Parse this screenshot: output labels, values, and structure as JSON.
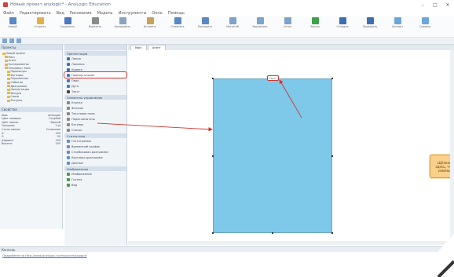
{
  "titlebar": {
    "title": "Новый проект.anylogic* - AnyLogic Education"
  },
  "window_controls": {
    "minimize": "–",
    "maximize": "□",
    "close": "✕"
  },
  "menubar": {
    "items": [
      "Файл",
      "Редактировать",
      "Вид",
      "Рисование",
      "Модель",
      "Инструменты",
      "Окно",
      "Помощь"
    ]
  },
  "ribbon": {
    "buttons": [
      {
        "label": "Новый",
        "color": "#5b87c7"
      },
      {
        "label": "Открыть",
        "color": "#e2b04a"
      },
      {
        "label": "Сохранить",
        "color": "#4a78b8"
      },
      {
        "label": "Вырезать",
        "color": "#8a8a8a"
      },
      {
        "label": "Копировать",
        "color": "#8aa3c2"
      },
      {
        "label": "Вставить",
        "color": "#c7a25b"
      },
      {
        "label": "Отменить",
        "color": "#5a88c0"
      },
      {
        "label": "Повторить",
        "color": "#5a88c0"
      },
      {
        "label": "Масштаб",
        "color": "#7ca3c9"
      },
      {
        "label": "Выровнять",
        "color": "#7ca3c9"
      },
      {
        "label": "Сетка",
        "color": "#7ca3c9"
      },
      {
        "label": "Запуск",
        "color": "#3fa14a"
      },
      {
        "label": "Отладка",
        "color": "#3d6fb0"
      },
      {
        "label": "Проверить",
        "color": "#3d6fb0"
      },
      {
        "label": "Экспорт",
        "color": "#6aa7d8"
      },
      {
        "label": "Справка",
        "color": "#6aa7d8"
      }
    ]
  },
  "left_panel": {
    "title": "Проекты",
    "tree": [
      "Новый проект",
      "Main",
      "Агент",
      "Эксперименты",
      "Simulation: Main",
      "Параметры",
      "Функции",
      "Переменные",
      "События",
      "Диаграммы",
      "Презентация",
      "Фигуры",
      "Связи",
      "Ресурсы"
    ],
    "props_title": "Свойства",
    "props": [
      {
        "k": "Имя:",
        "v": "rectangle"
      },
      {
        "k": "Цвет заливки:",
        "v": "Голубой"
      },
      {
        "k": "Цвет линии:",
        "v": "Чёрный"
      },
      {
        "k": "Толщина:",
        "v": "1 pt"
      },
      {
        "k": "Стиль линии:",
        "v": "Сплошная"
      },
      {
        "k": "X:",
        "v": "100"
      },
      {
        "k": "Y:",
        "v": "50"
      },
      {
        "k": "Ширина:",
        "v": "150"
      },
      {
        "k": "Высота:",
        "v": "200"
      }
    ]
  },
  "palette": {
    "sections": [
      {
        "title": "Презентация",
        "items": [
          {
            "label": "Линия",
            "color": "#3b6fb5"
          },
          {
            "label": "Ломаная",
            "color": "#3b6fb5"
          },
          {
            "label": "Кривая",
            "color": "#3b6fb5"
          },
          {
            "label": "Прямоугольник",
            "color": "#3a7bd5"
          },
          {
            "label": "Овал",
            "color": "#3a7bd5"
          },
          {
            "label": "Дуга",
            "color": "#3a7bd5"
          },
          {
            "label": "Текст",
            "color": "#444"
          }
        ]
      },
      {
        "title": "Элементы управления",
        "items": [
          {
            "label": "Кнопка",
            "color": "#888"
          },
          {
            "label": "Флажок",
            "color": "#888"
          },
          {
            "label": "Текстовое поле",
            "color": "#888"
          },
          {
            "label": "Переключатель",
            "color": "#888"
          },
          {
            "label": "Бегунок",
            "color": "#888"
          },
          {
            "label": "Список",
            "color": "#888"
          }
        ]
      },
      {
        "title": "Статистика",
        "items": [
          {
            "label": "Гистограмма",
            "color": "#5b8fd0"
          },
          {
            "label": "Временной график",
            "color": "#5b8fd0"
          },
          {
            "label": "Столбиковая диаграмма",
            "color": "#5b8fd0"
          },
          {
            "label": "Круговая диаграмма",
            "color": "#5b8fd0"
          },
          {
            "label": "Данные",
            "color": "#5b8fd0"
          }
        ]
      },
      {
        "title": "Изображения",
        "items": [
          {
            "label": "Изображение",
            "color": "#4a9a4a"
          },
          {
            "label": "Группа",
            "color": "#4a9a4a"
          },
          {
            "label": "Вид",
            "color": "#4a9a4a"
          }
        ]
      }
    ],
    "highlighted_item": "Прямоугольник"
  },
  "editor": {
    "tabs": [
      "Main",
      "Агент"
    ],
    "callout_text": "Щёлкните здесь, чтобы изменить",
    "anno_label": "Текст",
    "canvas_fill": "#7ec8ea"
  },
  "bottom_panel": {
    "title": "Консоль",
    "link": "Подробнее на http://www.anylogic.ru/resources/support"
  }
}
